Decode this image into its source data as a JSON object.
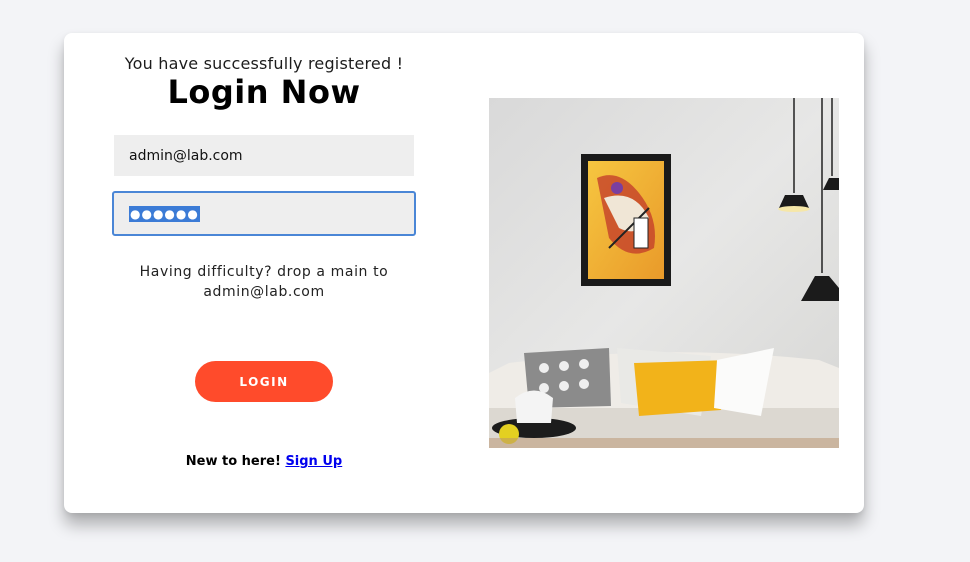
{
  "login": {
    "success_message": "You have successfully registered !",
    "title": "Login Now",
    "email_value": "admin@lab.com",
    "password_mask": "●●●●●●",
    "help_text_line1": "Having difficulty? drop a main to",
    "help_text_line2": "admin@lab.com",
    "login_button": "LOGIN",
    "signup_prompt": "New to here!",
    "signup_link": "Sign Up"
  },
  "colors": {
    "accent": "#ff4b2b",
    "focus_border": "#4a86d6",
    "background": "#f3f4f7"
  }
}
